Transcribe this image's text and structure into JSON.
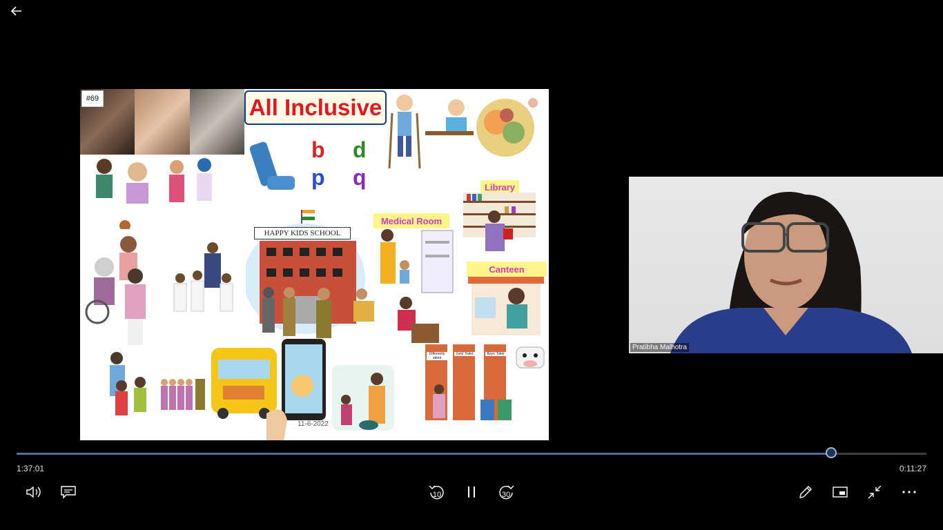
{
  "slide": {
    "number": "#69",
    "title": "All Inclusive",
    "labels": {
      "library": "Library",
      "medical_room": "Medical Room",
      "canteen": "Canteen",
      "school_sign": "HAPPY KIDS SCHOOL",
      "differently_abled": "Differently abled",
      "girls_toilet": "Girls' Toilet",
      "boys_toilet": "Boys' Toilet"
    },
    "letters": [
      "b",
      "d",
      "p",
      "q"
    ],
    "date": "11-6-2022"
  },
  "webcam": {
    "participant_name": "Pratibha Malhotra"
  },
  "player": {
    "elapsed": "1:37:01",
    "remaining": "0:11:27",
    "progress_fraction": 0.8955,
    "skip_back_seconds": "10",
    "skip_forward_seconds": "30"
  },
  "colors": {
    "background": "#000000",
    "progress_fill": "#4a6fa0",
    "title_red": "#e5161f",
    "label_pink": "#d63ab8",
    "label_yellow": "#fff58a"
  }
}
